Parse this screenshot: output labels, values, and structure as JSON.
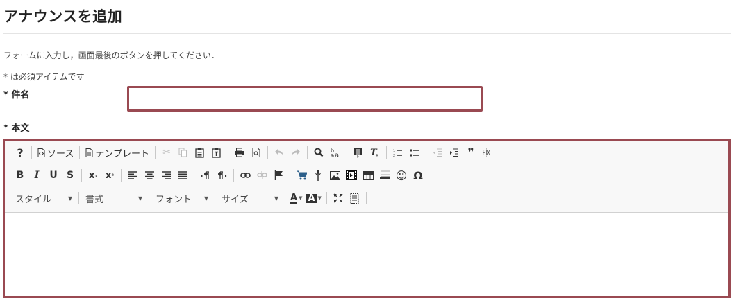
{
  "page": {
    "title": "アナウンスを追加",
    "instructions": "フォームに入力し，画面最後のボタンを押してください．",
    "required_note": "* は必須アイテムです"
  },
  "fields": {
    "subject_label": "* 件名",
    "subject_value": "",
    "body_label": "* 本文"
  },
  "toolbar": {
    "help": "?",
    "source_label": "ソース",
    "template_label": "テンプレート",
    "quote_glyph": "❞",
    "bold": "B",
    "italic": "I",
    "underline": "U",
    "strike": "S",
    "subscript": "x",
    "subscript_mark": "₂",
    "superscript": "x",
    "superscript_mark": "²",
    "omega": "Ω",
    "style_combo": "スタイル",
    "format_combo": "書式",
    "font_combo": "フォント",
    "size_combo": "サイズ",
    "text_color": "A",
    "bg_color": "A"
  },
  "colors": {
    "focus_border": "#9a4a52",
    "toolbar_bg": "#f8f8f8"
  }
}
